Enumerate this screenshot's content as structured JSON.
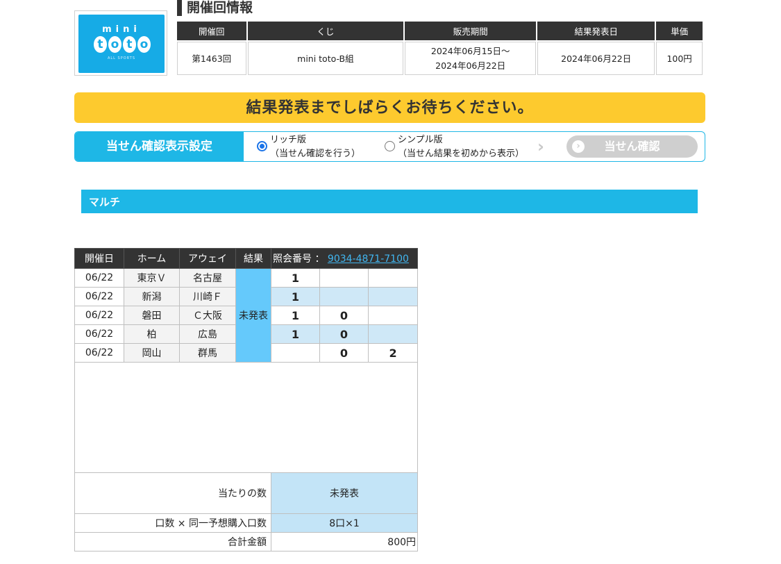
{
  "logo": {
    "mini": "mini",
    "toto_letters": [
      "t",
      "o",
      "t",
      "o"
    ],
    "sub": "ALL SPORTS"
  },
  "info": {
    "title": "開催回情報",
    "headers": [
      "開催回",
      "くじ",
      "販売期間",
      "結果発表日",
      "単価"
    ],
    "round": "第1463回",
    "lottery": "mini toto-B組",
    "sale_start": "2024年06月15日〜",
    "sale_end": "2024年06月22日",
    "result_date": "2024年06月22日",
    "unit_price": "100円"
  },
  "banner": {
    "text": "結果発表までしばらくお待ちください。"
  },
  "setting": {
    "label": "当せん確認表示設定",
    "rich_title": "リッチ版",
    "rich_desc": "（当せん確認を行う）",
    "simple_title": "シンプル版",
    "simple_desc": "（当せん結果を初めから表示）",
    "selected": "rich",
    "confirm_label": "当せん確認",
    "chevron_icon": "chevron-right-icon"
  },
  "multi": {
    "title": "マルチ"
  },
  "matches": {
    "headers": {
      "date": "開催日",
      "home": "ホーム",
      "away": "アウェイ",
      "result": "結果",
      "ref_label": "照会番号 ：",
      "ref_number": "9034-4871-7100"
    },
    "result_status": "未発表",
    "rows": [
      {
        "date": "06/22",
        "home": "東京Ｖ",
        "away": "名古屋",
        "p1": "1",
        "p0": "",
        "p2": ""
      },
      {
        "date": "06/22",
        "home": "新潟",
        "away": "川崎Ｆ",
        "p1": "1",
        "p0": "",
        "p2": ""
      },
      {
        "date": "06/22",
        "home": "磐田",
        "away": "Ｃ大阪",
        "p1": "1",
        "p0": "0",
        "p2": ""
      },
      {
        "date": "06/22",
        "home": "柏",
        "away": "広島",
        "p1": "1",
        "p0": "0",
        "p2": ""
      },
      {
        "date": "06/22",
        "home": "岡山",
        "away": "群馬",
        "p1": "",
        "p0": "0",
        "p2": "2"
      }
    ],
    "summary": {
      "hits_label": "当たりの数",
      "hits_value": "未発表",
      "units_label": "口数 × 同一予想購入口数",
      "units_value": "8口×1",
      "total_label": "合計金額",
      "total_value": "800円"
    }
  }
}
